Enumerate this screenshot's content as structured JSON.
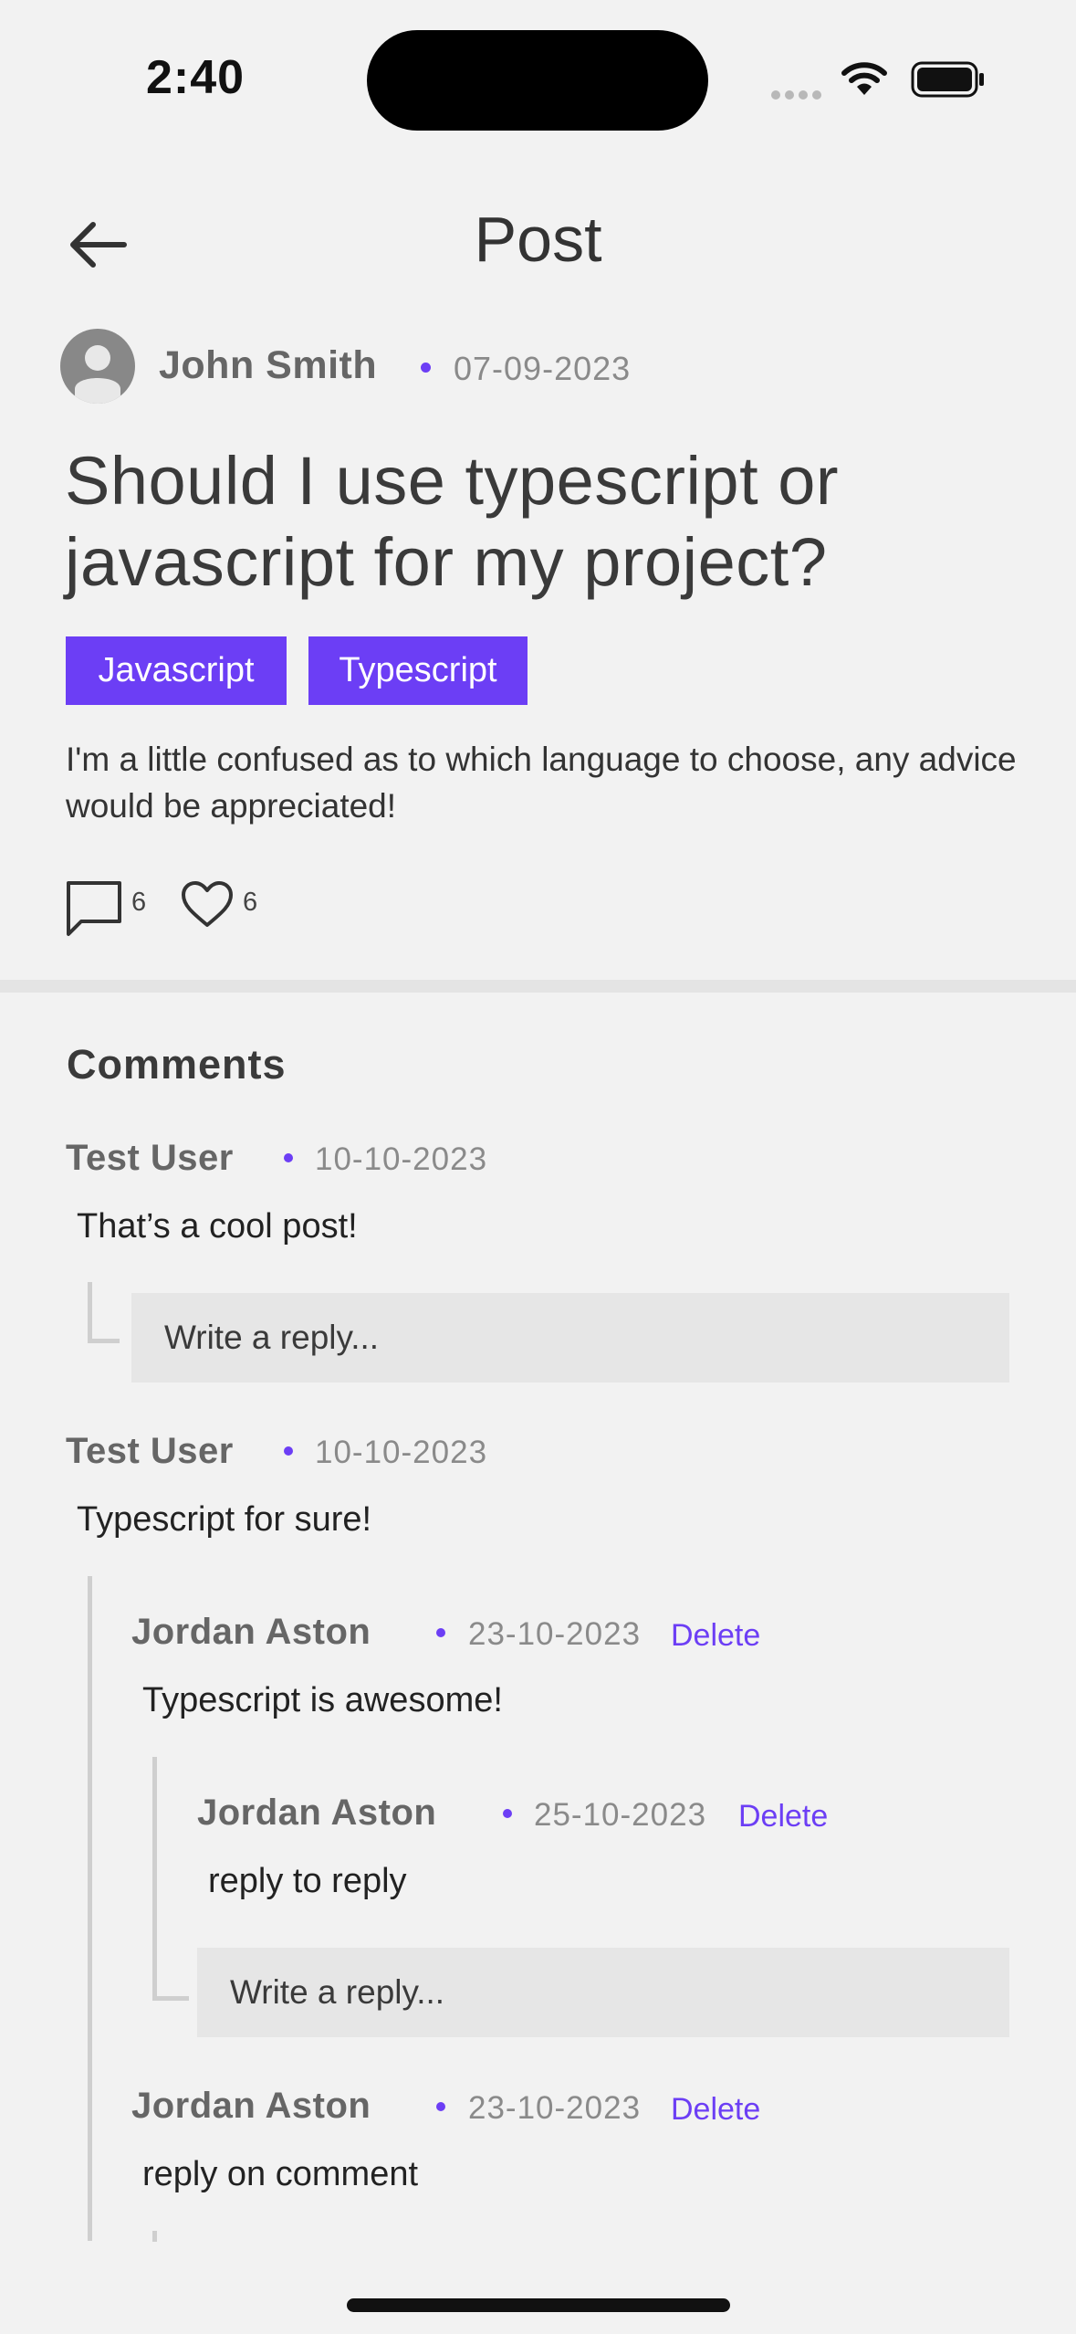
{
  "status_bar": {
    "time": "2:40"
  },
  "header": {
    "title": "Post"
  },
  "post": {
    "author": "John Smith",
    "date": "07-09-2023",
    "title": "Should I use typescript or javascript for my project?",
    "tags": [
      "Javascript",
      "Typescript"
    ],
    "body": "I'm a little confused as to which language to choose, any advice would be appreciated!",
    "comment_count": "6",
    "like_count": "6"
  },
  "comments_section": {
    "heading": "Comments",
    "reply_placeholder": "Write a reply...",
    "delete_label": "Delete",
    "comments": [
      {
        "author": "Test User",
        "date": "10-10-2023",
        "text": "That’s a cool post!"
      },
      {
        "author": "Test User",
        "date": "10-10-2023",
        "text": "Typescript for sure!",
        "replies": [
          {
            "author": "Jordan Aston",
            "date": "23-10-2023",
            "text": "Typescript is awesome!",
            "replies": [
              {
                "author": "Jordan Aston",
                "date": "25-10-2023",
                "text": "reply to reply"
              }
            ]
          },
          {
            "author": "Jordan Aston",
            "date": "23-10-2023",
            "text": "reply on comment"
          }
        ]
      }
    ]
  },
  "colors": {
    "accent": "#6c3ef5",
    "background": "#f2f2f2",
    "reply_box": "#e6e6e6"
  }
}
